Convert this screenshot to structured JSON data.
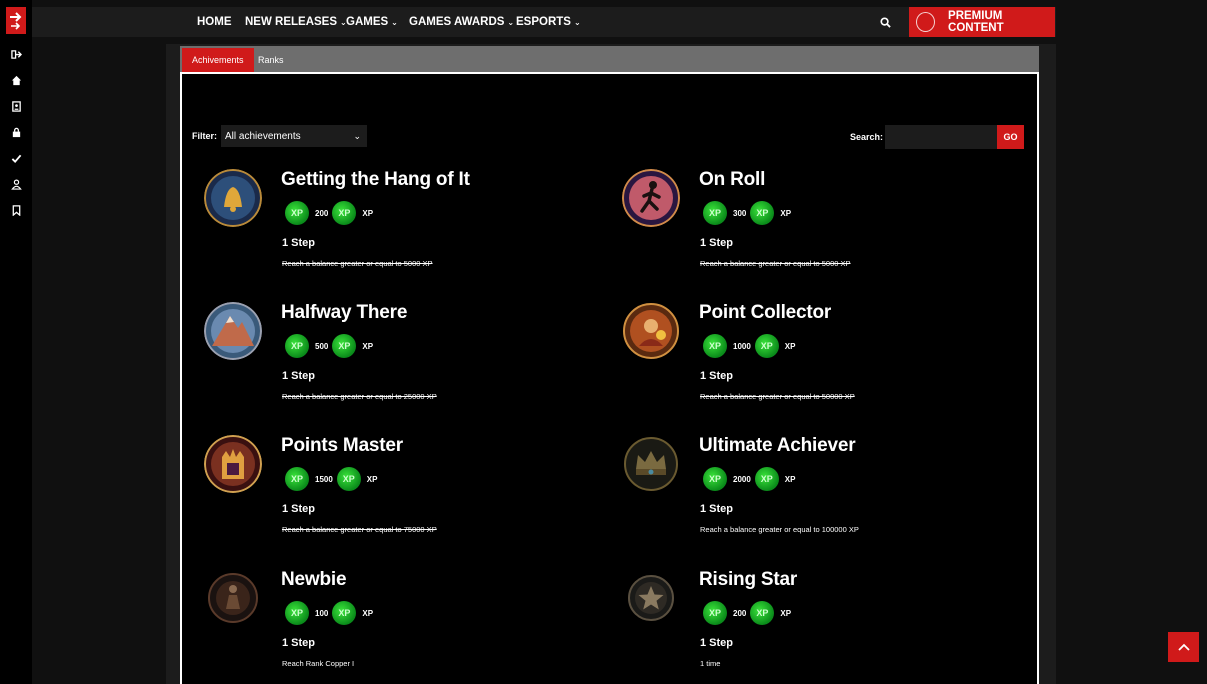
{
  "nav": {
    "items": [
      {
        "label": "HOME",
        "dropdown": false
      },
      {
        "label": "NEW RELEASES",
        "dropdown": true
      },
      {
        "label": "GAMES",
        "dropdown": true
      },
      {
        "label": "GAMES AWARDS",
        "dropdown": true
      },
      {
        "label": "ESPORTS",
        "dropdown": true
      }
    ],
    "premium_label": "PREMIUM CONTENT"
  },
  "tabs": {
    "active": "Achivements",
    "inactive": "Ranks"
  },
  "filter": {
    "label": "Filter:",
    "selected": "All achievements"
  },
  "search": {
    "label": "Search:",
    "go": "GO"
  },
  "achievements": [
    {
      "title": "Getting the Hang of It",
      "xp": "200",
      "xp_unit": "XP",
      "steps": "1 Step",
      "requirement": "Reach a balance greater or equal to 5000 XP",
      "completed": true
    },
    {
      "title": "On Roll",
      "xp": "300",
      "xp_unit": "XP",
      "steps": "1 Step",
      "requirement": "Reach a balance greater or equal to 5000 XP",
      "completed": true
    },
    {
      "title": "Halfway There",
      "xp": "500",
      "xp_unit": "XP",
      "steps": "1 Step",
      "requirement": "Reach a balance greater or equal to 25000 XP",
      "completed": true
    },
    {
      "title": "Point Collector",
      "xp": "1000",
      "xp_unit": "XP",
      "steps": "1 Step",
      "requirement": "Reach a balance greater or equal to 50000 XP",
      "completed": true
    },
    {
      "title": "Points Master",
      "xp": "1500",
      "xp_unit": "XP",
      "steps": "1 Step",
      "requirement": "Reach a balance greater or equal to 75000 XP",
      "completed": true
    },
    {
      "title": "Ultimate Achiever",
      "xp": "2000",
      "xp_unit": "XP",
      "steps": "1 Step",
      "requirement": "Reach a balance greater or equal to 100000 XP",
      "completed": false
    },
    {
      "title": "Newbie",
      "xp": "100",
      "xp_unit": "XP",
      "steps": "1 Step",
      "requirement": "Reach Rank Copper I",
      "completed": false
    },
    {
      "title": "Rising Star",
      "xp": "200",
      "xp_unit": "XP",
      "steps": "1 Step",
      "requirement": "1 time",
      "completed": false
    }
  ],
  "colors": {
    "accent": "#d01a1a",
    "xp_green": "#22c42a"
  }
}
